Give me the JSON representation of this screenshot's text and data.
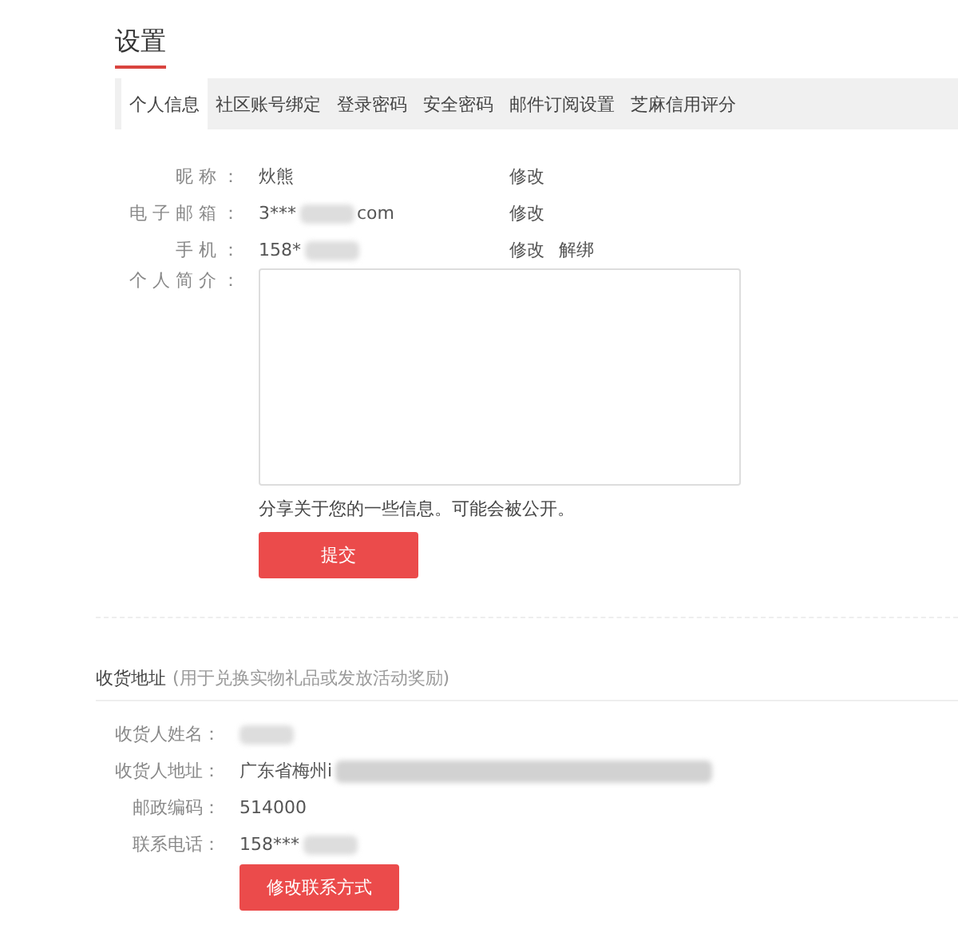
{
  "title": "设置",
  "tabs": [
    {
      "label": "个人信息",
      "selected": true
    },
    {
      "label": "社区账号绑定",
      "selected": false
    },
    {
      "label": "登录密码",
      "selected": false
    },
    {
      "label": "安全密码",
      "selected": false
    },
    {
      "label": "邮件订阅设置",
      "selected": false
    },
    {
      "label": "芝麻信用评分",
      "selected": false
    }
  ],
  "profile": {
    "fields": [
      {
        "label": "昵 称 ：",
        "value": "炏熊",
        "actions": [
          "修改"
        ]
      },
      {
        "label": "电 子 邮 箱 ：",
        "value": "3***",
        "suffix": "com",
        "redacted": true,
        "actions": [
          "修改"
        ]
      },
      {
        "label": "手 机 ：",
        "value": "158*",
        "redacted": true,
        "actions": [
          "修改",
          "解绑"
        ]
      }
    ],
    "bio": {
      "label": "个 人 简 介 ：",
      "hint": "分享关于您的一些信息。可能会被公开。"
    },
    "submit": "提交"
  },
  "address": {
    "title": "收货地址",
    "note": "(用于兑换实物礼品或发放活动奖励)",
    "fields": [
      {
        "label": "收货人姓名：",
        "redacted": true
      },
      {
        "label": "收货人地址：",
        "value": "广东省梅州i",
        "redacted": true
      },
      {
        "label": "邮政编码：",
        "value": "514000"
      },
      {
        "label": "联系电话：",
        "value": "158***",
        "redacted": true
      }
    ],
    "button": "修改联系方式"
  }
}
